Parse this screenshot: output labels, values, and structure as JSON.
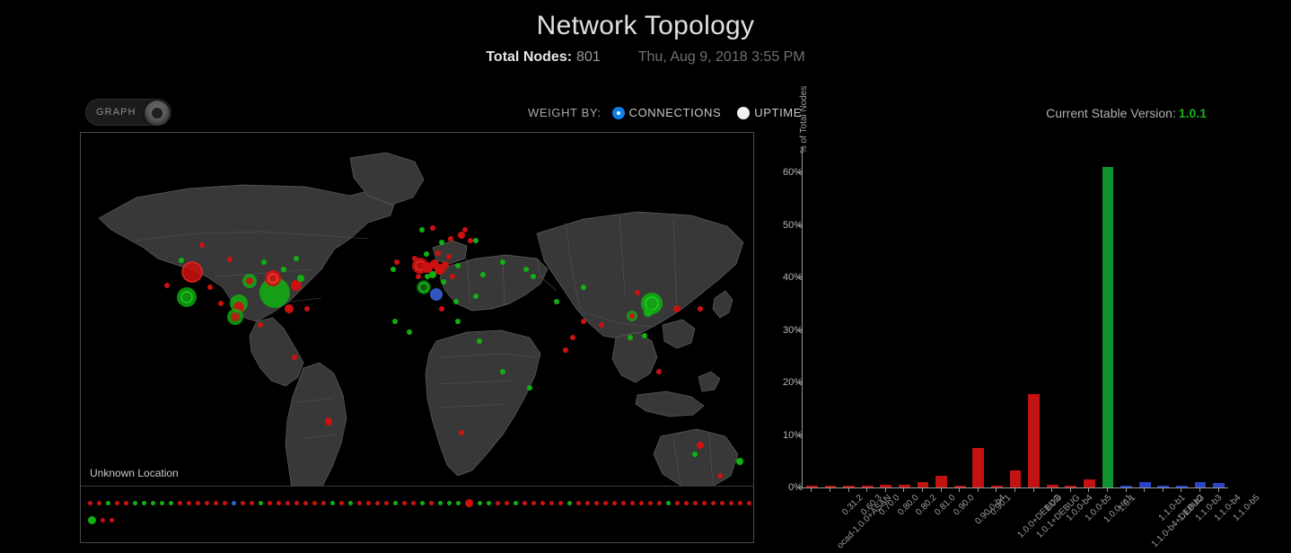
{
  "header": {
    "title": "Network Topology",
    "total_nodes_label": "Total Nodes:",
    "total_nodes_value": "801",
    "timestamp": "Thu, Aug 9, 2018 3:55 PM"
  },
  "toolbar": {
    "graph_toggle_label": "GRAPH",
    "graph_toggle_state": "on",
    "weight_by_label": "WEIGHT BY:",
    "weight_options": [
      {
        "label": "CONNECTIONS",
        "selected": true
      },
      {
        "label": "UPTIME",
        "selected": false
      }
    ],
    "version_label": "Current Stable Version:",
    "version_value": "1.0.1",
    "version_color": "#19b319"
  },
  "map": {
    "unknown_location_label": "Unknown Location",
    "colors": {
      "land": "#3a3a3a",
      "border": "#6a6a6a",
      "ocean": "#000000",
      "node_green": "#12b012",
      "node_red": "#cc1111",
      "node_blue": "#3a5fd0"
    },
    "unknown_nodes_row1": [
      "red",
      "red",
      "green",
      "red",
      "red",
      "green",
      "green",
      "green",
      "green",
      "green",
      "red",
      "red",
      "red",
      "red",
      "red",
      "red",
      "blue",
      "red",
      "red",
      "green",
      "red",
      "red",
      "red",
      "red",
      "red",
      "red",
      "red",
      "green",
      "red",
      "green",
      "red",
      "red",
      "red",
      "red",
      "green",
      "red",
      "red",
      "green",
      "red",
      "green",
      "green",
      "green",
      "red",
      "green",
      "green",
      "red",
      "red",
      "green",
      "red",
      "red",
      "red",
      "red",
      "red",
      "green",
      "red",
      "red",
      "red",
      "red",
      "red",
      "red",
      "red",
      "red",
      "red",
      "red",
      "green",
      "red",
      "red",
      "red",
      "red",
      "red",
      "red",
      "red",
      "red",
      "red",
      "red",
      "red"
    ],
    "unknown_nodes_row2": [
      "green",
      "red",
      "red"
    ]
  },
  "chart_data": {
    "type": "bar",
    "title": "",
    "xlabel": "",
    "ylabel": "% of Total Nodes",
    "ylim": [
      0,
      65
    ],
    "ytick_labels": [
      "0%",
      "10%",
      "20%",
      "30%",
      "40%",
      "50%",
      "60%"
    ],
    "ytick_values": [
      0,
      10,
      20,
      30,
      40,
      50,
      60
    ],
    "grid": false,
    "legend": "none",
    "categories": [
      "ocad-1.0.0+ASAN",
      "0.31.2",
      "0.60.3",
      "0.70.0",
      "0.80.0",
      "0.80.2",
      "0.81.0",
      "0.90.0",
      "0.90.0-b4",
      "0.90.1",
      "1.0.0+DEBUG",
      "1.0.1+DEBUG",
      "1.0.0",
      "1.0.0-b4",
      "1.0.0-b5",
      "1.0.0-rc1",
      "1.0.1",
      "1.1.0-b4+DEBUG",
      "1.1.0-b1",
      "1.1.0-b2",
      "1.1.0-b3",
      "1.1.0-b4",
      "1.1.0-b5"
    ],
    "values": [
      0.3,
      0.3,
      0.4,
      0.4,
      0.5,
      0.6,
      1.1,
      2.2,
      0.4,
      7.6,
      0.4,
      3.2,
      17.8,
      0.5,
      0.4,
      1.5,
      61.0,
      0.4,
      1.0,
      0.4,
      0.4,
      1.0,
      0.8
    ],
    "bar_colors": [
      "#c21212",
      "#c21212",
      "#c21212",
      "#c21212",
      "#c21212",
      "#c21212",
      "#c21212",
      "#c21212",
      "#c21212",
      "#c21212",
      "#c21212",
      "#c21212",
      "#c21212",
      "#c21212",
      "#c21212",
      "#c21212",
      "#11912f",
      "#2a44c8",
      "#2a44c8",
      "#2a44c8",
      "#2a44c8",
      "#2a44c8",
      "#2a44c8"
    ]
  }
}
